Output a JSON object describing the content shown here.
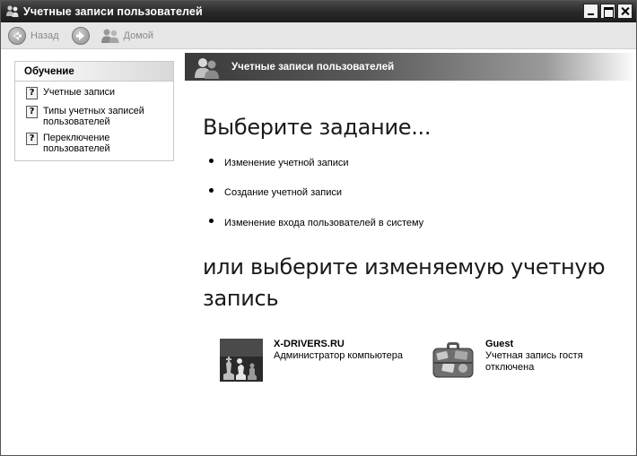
{
  "window": {
    "title": "Учетные записи пользователей"
  },
  "toolbar": {
    "back_label": "Назад",
    "home_label": "Домой"
  },
  "sidebar": {
    "panel_title": "Обучение",
    "items": [
      {
        "label": "Учетные записи",
        "icon": "help-topic-icon"
      },
      {
        "label": "Типы учетных записей пользователей",
        "icon": "help-topic-icon"
      },
      {
        "label": "Переключение пользователей",
        "icon": "help-topic-icon"
      }
    ]
  },
  "header": {
    "title": "Учетные записи пользователей"
  },
  "main": {
    "pick_task_heading": "Выберите задание...",
    "tasks": [
      {
        "label": "Изменение учетной записи"
      },
      {
        "label": "Создание учетной записи"
      },
      {
        "label": "Изменение входа пользователей в систему"
      }
    ],
    "pick_account_heading": "или выберите изменяемую учетную запись",
    "accounts": [
      {
        "name": "X-DRIVERS.RU",
        "type": "Администратор компьютера",
        "picture": "chess-icon"
      },
      {
        "name": "Guest",
        "type": "Учетная запись гостя отключена",
        "picture": "suitcase-icon"
      }
    ]
  },
  "colors": {
    "titlebar": "#2a2a2a",
    "toolbar": "#e6e6e6",
    "header_band": "#3a3a3a"
  }
}
